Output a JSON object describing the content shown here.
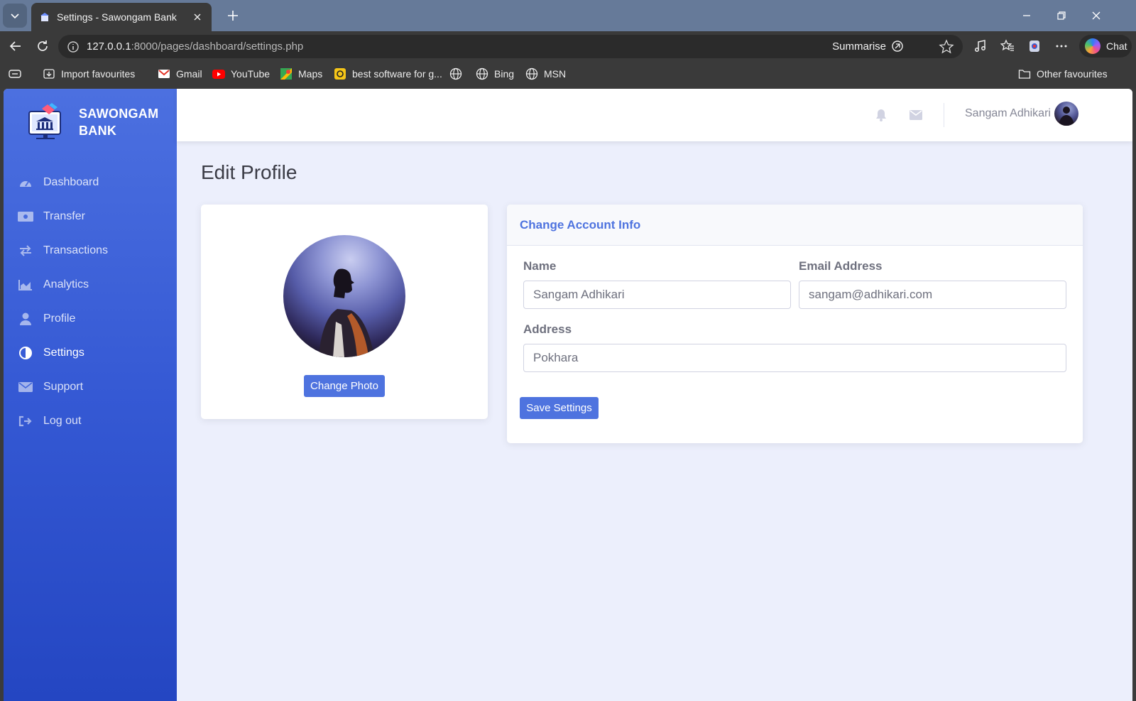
{
  "browser": {
    "tab_title": "Settings - Sawongam Bank",
    "url_host": "127.0.0.1",
    "url_path": ":8000/pages/dashboard/settings.php",
    "summarise_label": "Summarise",
    "chat_label": "Chat",
    "favourites": {
      "import": "Import favourites",
      "gmail": "Gmail",
      "youtube": "YouTube",
      "maps": "Maps",
      "best_software": "best software for g...",
      "bing": "Bing",
      "msn": "MSN",
      "other": "Other favourites"
    }
  },
  "brand": {
    "name": "SAWONGAM BANK"
  },
  "sidebar": {
    "items": [
      {
        "label": "Dashboard",
        "icon": "gauge-icon"
      },
      {
        "label": "Transfer",
        "icon": "money-bill-icon"
      },
      {
        "label": "Transactions",
        "icon": "exchange-icon"
      },
      {
        "label": "Analytics",
        "icon": "area-chart-icon"
      },
      {
        "label": "Profile",
        "icon": "user-icon"
      },
      {
        "label": "Settings",
        "icon": "adjust-icon",
        "active": true
      },
      {
        "label": "Support",
        "icon": "envelope-icon"
      },
      {
        "label": "Log out",
        "icon": "sign-out-icon"
      }
    ]
  },
  "topbar": {
    "user_name": "Sangam Adhikari"
  },
  "page": {
    "title": "Edit Profile",
    "change_photo_label": "Change Photo",
    "account_card": {
      "title": "Change Account Info",
      "name_label": "Name",
      "name_value": "Sangam Adhikari",
      "email_label": "Email Address",
      "email_value": "sangam@adhikari.com",
      "address_label": "Address",
      "address_value": "Pokhara",
      "save_label": "Save Settings"
    }
  },
  "colors": {
    "primary": "#4e73df",
    "sidebar_top": "#4c70e0",
    "sidebar_bottom": "#2446c2",
    "page_bg": "#eceffc"
  }
}
